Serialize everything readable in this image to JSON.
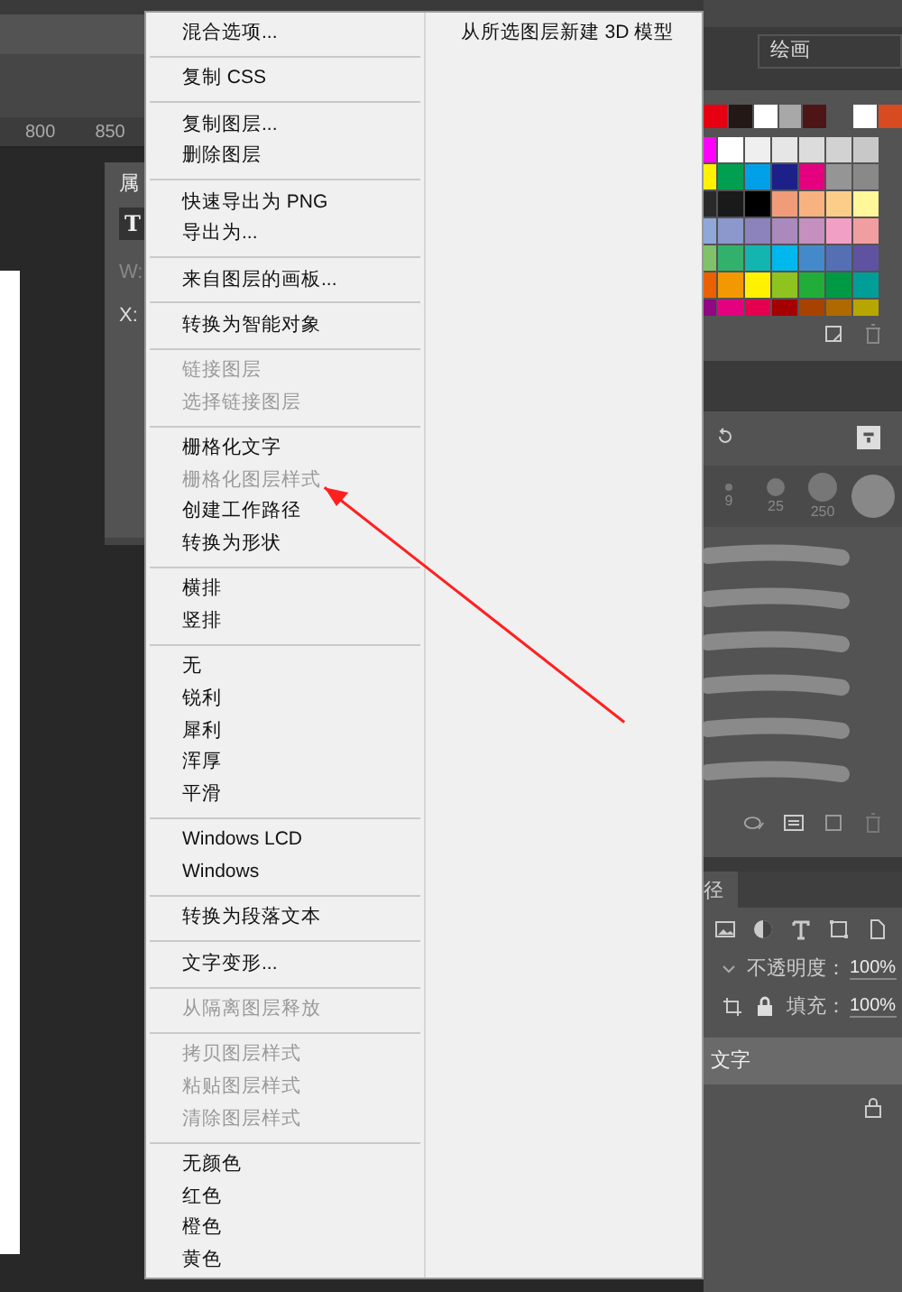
{
  "document": {
    "ruler_marks": [
      "800",
      "850"
    ]
  },
  "properties_panel": {
    "title": "属",
    "type_glyph": "T",
    "fields": [
      {
        "label": "W:",
        "disabled": true
      },
      {
        "label": "X:",
        "disabled": false
      }
    ]
  },
  "mode_dropdown": {
    "value": "绘画"
  },
  "swatches": {
    "recent": [
      {
        "color": "#e60012"
      },
      {
        "color": "#231815"
      },
      {
        "color": "#ffffff"
      },
      {
        "color": "#a8a8a8"
      },
      {
        "color": "#4d1515"
      },
      {
        "color": "#ffffff"
      },
      {
        "color": "#d84b20"
      }
    ],
    "grid": [
      [
        {
          "color": "#ff00ff"
        },
        {
          "color": "#ffffff"
        },
        {
          "color": "#efefef"
        },
        {
          "color": "#e6e6e6"
        },
        {
          "color": "#dcdcdc"
        },
        {
          "color": "#d2d2d2"
        },
        {
          "color": "#c8c8c8"
        }
      ],
      [
        {
          "color": "#fff200"
        },
        {
          "color": "#00a050"
        },
        {
          "color": "#00a0e9"
        },
        {
          "color": "#1d2088"
        },
        {
          "color": "#e4007f"
        },
        {
          "color": "#959595"
        },
        {
          "color": "#898989"
        }
      ],
      [
        {
          "color": "#2a2a2a"
        },
        {
          "color": "#1a1a1a"
        },
        {
          "color": "#000000"
        },
        {
          "color": "#f19c79"
        },
        {
          "color": "#f7b27f"
        },
        {
          "color": "#facd89"
        },
        {
          "color": "#fff799"
        }
      ],
      [
        {
          "color": "#8fa8d8"
        },
        {
          "color": "#8c97cb"
        },
        {
          "color": "#8c82bc"
        },
        {
          "color": "#aa89bd"
        },
        {
          "color": "#c490bf"
        },
        {
          "color": "#f29fc5"
        },
        {
          "color": "#f19ea1"
        }
      ],
      [
        {
          "color": "#80c269"
        },
        {
          "color": "#32b16c"
        },
        {
          "color": "#13b5b1"
        },
        {
          "color": "#00b7ee"
        },
        {
          "color": "#448aca"
        },
        {
          "color": "#556fb5"
        },
        {
          "color": "#5f52a0"
        }
      ],
      [
        {
          "color": "#eb6100"
        },
        {
          "color": "#f39800"
        },
        {
          "color": "#fff100"
        },
        {
          "color": "#8fc31f"
        },
        {
          "color": "#22ac38"
        },
        {
          "color": "#009944"
        },
        {
          "color": "#009e96"
        }
      ],
      [
        {
          "color": "#920783"
        },
        {
          "color": "#e4007f"
        },
        {
          "color": "#e5004f"
        },
        {
          "color": "#a40000"
        },
        {
          "color": "#a84200"
        },
        {
          "color": "#ae6a00"
        },
        {
          "color": "#b8a600"
        }
      ]
    ]
  },
  "brushes": {
    "sizes": [
      "9",
      "25",
      "250"
    ]
  },
  "layers_panel": {
    "tab": "径",
    "opacity_label": "不透明度：",
    "opacity": "100%",
    "fill_label": "填充：",
    "fill": "100%",
    "layers": [
      {
        "name": "文字",
        "selected": true
      }
    ]
  },
  "context_menu": {
    "left_groups": [
      [
        {
          "label": "混合选项...",
          "disabled": false
        }
      ],
      [
        {
          "label": "复制 CSS",
          "disabled": false
        }
      ],
      [
        {
          "label": "复制图层...",
          "disabled": false
        },
        {
          "label": "删除图层",
          "disabled": false
        }
      ],
      [
        {
          "label": "快速导出为 PNG",
          "disabled": false
        },
        {
          "label": "导出为...",
          "disabled": false
        }
      ],
      [
        {
          "label": "来自图层的画板...",
          "disabled": false
        }
      ],
      [
        {
          "label": "转换为智能对象",
          "disabled": false
        }
      ],
      [
        {
          "label": "链接图层",
          "disabled": true
        },
        {
          "label": "选择链接图层",
          "disabled": true
        }
      ],
      [
        {
          "label": "栅格化文字",
          "disabled": false
        },
        {
          "label": "栅格化图层样式",
          "disabled": true
        },
        {
          "label": "创建工作路径",
          "disabled": false
        },
        {
          "label": "转换为形状",
          "disabled": false
        }
      ],
      [
        {
          "label": "横排",
          "disabled": false
        },
        {
          "label": "竖排",
          "disabled": false
        }
      ],
      [
        {
          "label": "无",
          "disabled": false
        },
        {
          "label": "锐利",
          "disabled": false
        },
        {
          "label": "犀利",
          "disabled": false
        },
        {
          "label": "浑厚",
          "disabled": false
        },
        {
          "label": "平滑",
          "disabled": false
        }
      ],
      [
        {
          "label": "Windows LCD",
          "disabled": false
        },
        {
          "label": "Windows",
          "disabled": false
        }
      ],
      [
        {
          "label": "转换为段落文本",
          "disabled": false
        }
      ],
      [
        {
          "label": "文字变形...",
          "disabled": false
        }
      ],
      [
        {
          "label": "从隔离图层释放",
          "disabled": true
        }
      ],
      [
        {
          "label": "拷贝图层样式",
          "disabled": true
        },
        {
          "label": "粘贴图层样式",
          "disabled": true
        },
        {
          "label": "清除图层样式",
          "disabled": true
        }
      ],
      [
        {
          "label": "无颜色",
          "disabled": false
        },
        {
          "label": "红色",
          "disabled": false
        },
        {
          "label": "橙色",
          "disabled": false
        },
        {
          "label": "黄色",
          "disabled": false
        }
      ]
    ],
    "right_items": [
      {
        "label": "从所选图层新建 3D 模型",
        "disabled": false
      }
    ]
  }
}
